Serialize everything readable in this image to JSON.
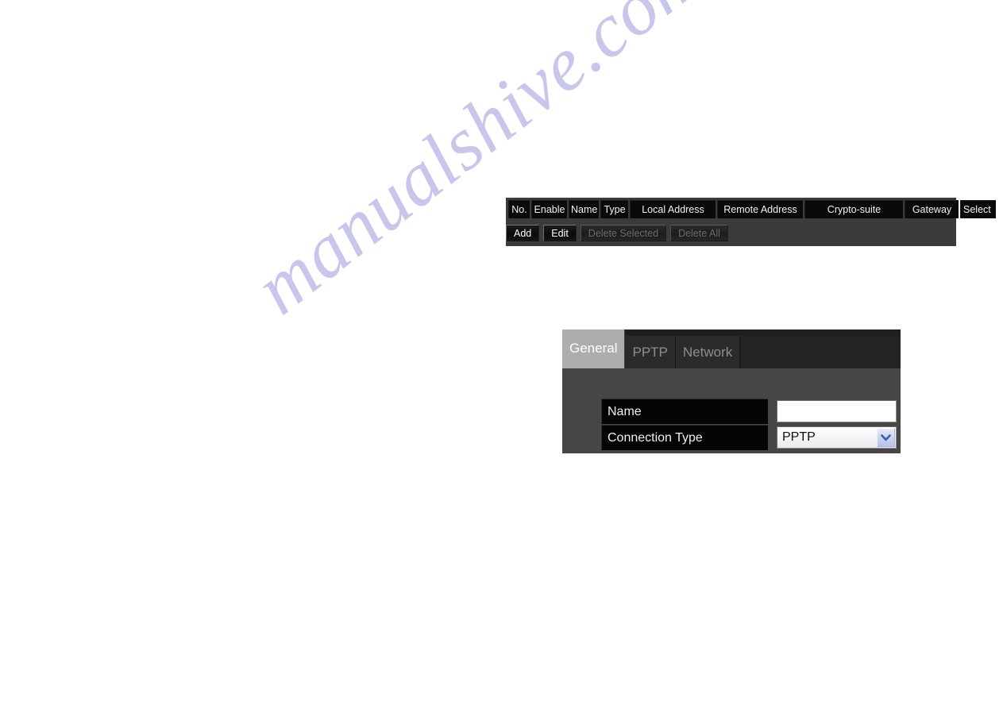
{
  "watermark": {
    "text": "manualshive.com"
  },
  "tunnel_list": {
    "columns": [
      {
        "key": "no",
        "label": "No."
      },
      {
        "key": "enable",
        "label": "Enable"
      },
      {
        "key": "name",
        "label": "Name"
      },
      {
        "key": "type",
        "label": "Type"
      },
      {
        "key": "local",
        "label": "Local Address"
      },
      {
        "key": "remote",
        "label": "Remote Address"
      },
      {
        "key": "crypto",
        "label": "Crypto-suite"
      },
      {
        "key": "gateway",
        "label": "Gateway"
      },
      {
        "key": "select",
        "label": "Select"
      }
    ],
    "rows": [],
    "buttons": [
      {
        "key": "add",
        "label": "Add",
        "disabled": false
      },
      {
        "key": "edit",
        "label": "Edit",
        "disabled": false
      },
      {
        "key": "delete_selected",
        "label": "Delete Selected",
        "disabled": true
      },
      {
        "key": "delete_all",
        "label": "Delete All",
        "disabled": true
      }
    ]
  },
  "connection_dialog": {
    "tabs": [
      {
        "key": "general",
        "label": "General",
        "active": true
      },
      {
        "key": "pptp",
        "label": "PPTP",
        "active": false
      },
      {
        "key": "network",
        "label": "Network",
        "active": false
      }
    ],
    "fields": {
      "name": {
        "label": "Name",
        "value": "",
        "placeholder": ""
      },
      "connection_type": {
        "label": "Connection Type",
        "value": "PPTP",
        "options": [
          "PPTP"
        ]
      }
    }
  },
  "colors": {
    "page_background": "#ffffff",
    "panel_background": "#3b3b3b",
    "form_background": "#464646",
    "tabbar_background": "#1f1f1f",
    "active_tab": "#adadad",
    "field_label_background": "#050505",
    "watermark": "#c6c3e9"
  }
}
